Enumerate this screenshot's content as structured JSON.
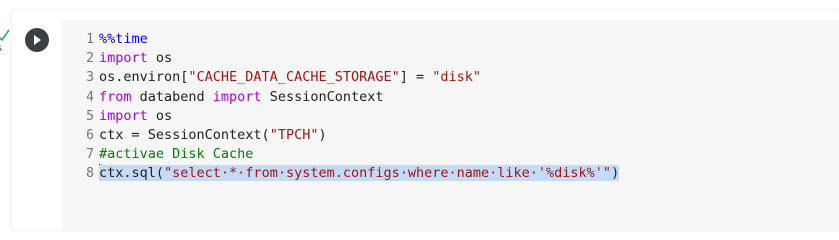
{
  "cell": {
    "execution": {
      "status_icon": "check-icon",
      "time_label": "s"
    },
    "run_button_icon": "play-icon",
    "lines": [
      {
        "number": "1",
        "tokens": [
          {
            "t": "%%time",
            "k": "magic"
          }
        ]
      },
      {
        "number": "2",
        "tokens": [
          {
            "t": "import",
            "k": "kw"
          },
          {
            "t": " os",
            "k": "plain"
          }
        ]
      },
      {
        "number": "3",
        "tokens": [
          {
            "t": "os.environ[",
            "k": "plain"
          },
          {
            "t": "\"CACHE_DATA_CACHE_STORAGE\"",
            "k": "str"
          },
          {
            "t": "] = ",
            "k": "plain"
          },
          {
            "t": "\"disk\"",
            "k": "str"
          }
        ]
      },
      {
        "number": "4",
        "tokens": [
          {
            "t": "from",
            "k": "kw"
          },
          {
            "t": " databend ",
            "k": "plain"
          },
          {
            "t": "import",
            "k": "kw"
          },
          {
            "t": " SessionContext",
            "k": "plain"
          }
        ]
      },
      {
        "number": "5",
        "tokens": [
          {
            "t": "import",
            "k": "kw"
          },
          {
            "t": " os",
            "k": "plain"
          }
        ]
      },
      {
        "number": "6",
        "tokens": [
          {
            "t": "ctx = SessionContext(",
            "k": "plain"
          },
          {
            "t": "\"TPCH\"",
            "k": "str"
          },
          {
            "t": ")",
            "k": "plain"
          }
        ]
      },
      {
        "number": "7",
        "tokens": [
          {
            "t": "#activae Disk Cache",
            "k": "comment"
          }
        ]
      },
      {
        "number": "8",
        "selected": true,
        "tokens": [
          {
            "t": "ctx.sql(",
            "k": "plain"
          },
          {
            "t": "\"select·*·from·system.configs·where·name·like·'%disk%'\"",
            "k": "str"
          },
          {
            "t": ")",
            "k": "plain"
          }
        ]
      }
    ]
  },
  "colors": {
    "keyword": "#af00db",
    "magic": "#0000ff",
    "string": "#a31515",
    "comment": "#008000",
    "selection": "#c3dbf7",
    "editor_bg": "#f7f7f7",
    "run_button": "#3c4043",
    "check": "#34a853"
  }
}
